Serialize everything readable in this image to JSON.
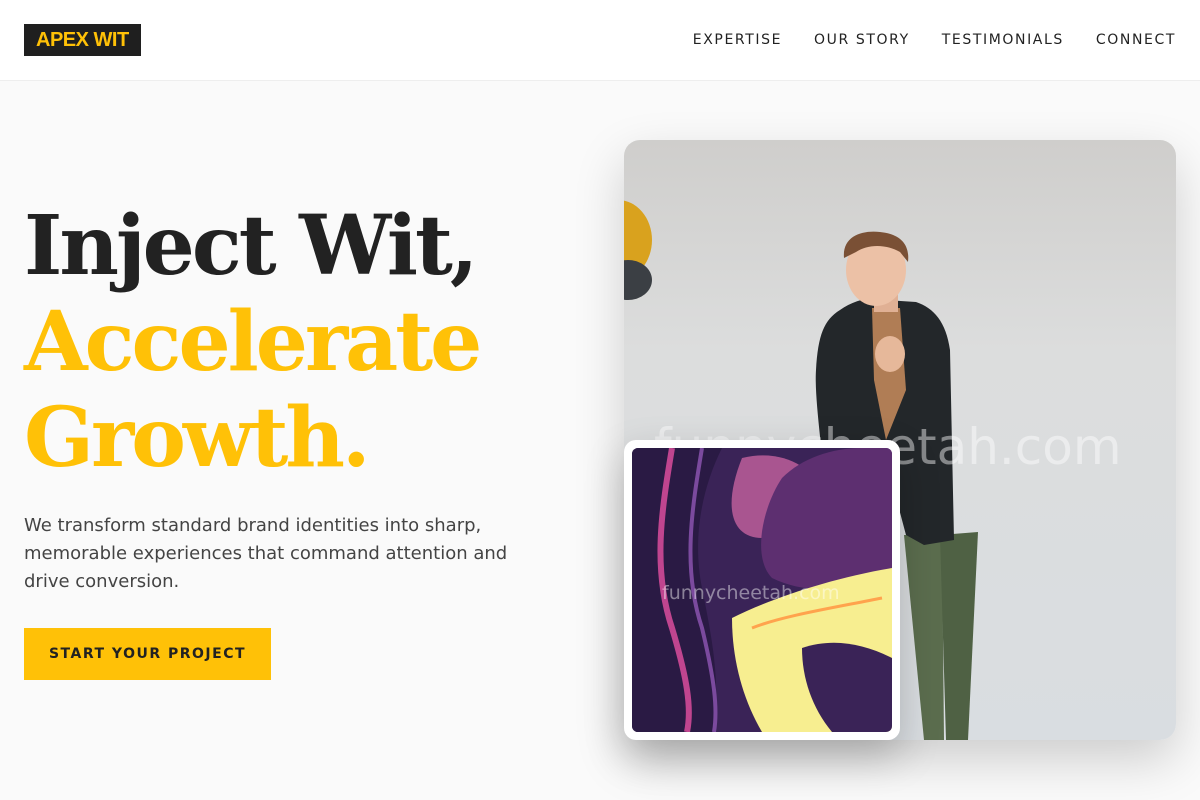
{
  "brand": {
    "logo_text": "APEX WIT",
    "accent_color": "#ffc107",
    "dark_color": "#1f1f1f"
  },
  "nav": {
    "items": [
      {
        "label": "EXPERTISE"
      },
      {
        "label": "OUR STORY"
      },
      {
        "label": "TESTIMONIALS"
      },
      {
        "label": "CONNECT"
      }
    ]
  },
  "hero": {
    "headline_line1": "Inject Wit,",
    "headline_line2": "Accelerate",
    "headline_line3": "Growth.",
    "subtext": "We transform standard brand identities into sharp, memorable experiences that command attention and drive conversion.",
    "cta_label": "START YOUR PROJECT"
  },
  "media": {
    "watermark_text": "funnycheetah.com",
    "photo_icon": "man-in-blazer-photo",
    "art_icon": "abstract-purple-yellow-art"
  }
}
